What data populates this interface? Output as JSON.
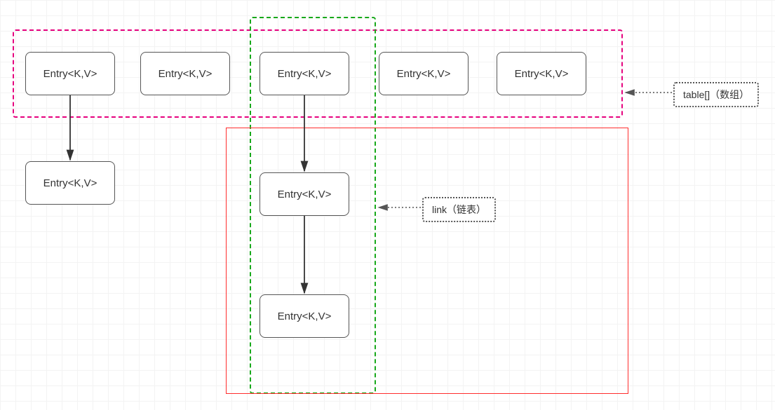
{
  "entries": {
    "row": [
      "Entry<K,V>",
      "Entry<K,V>",
      "Entry<K,V>",
      "Entry<K,V>",
      "Entry<K,V>"
    ],
    "chain_left": "Entry<K,V>",
    "chain_mid_1": "Entry<K,V>",
    "chain_mid_2": "Entry<K,V>"
  },
  "labels": {
    "table": "table[]（数组）",
    "link": "link（链表）"
  },
  "colors": {
    "magenta": "#e6007e",
    "green": "#17a81a",
    "red": "#ff2d2d",
    "node_border": "#555555"
  }
}
